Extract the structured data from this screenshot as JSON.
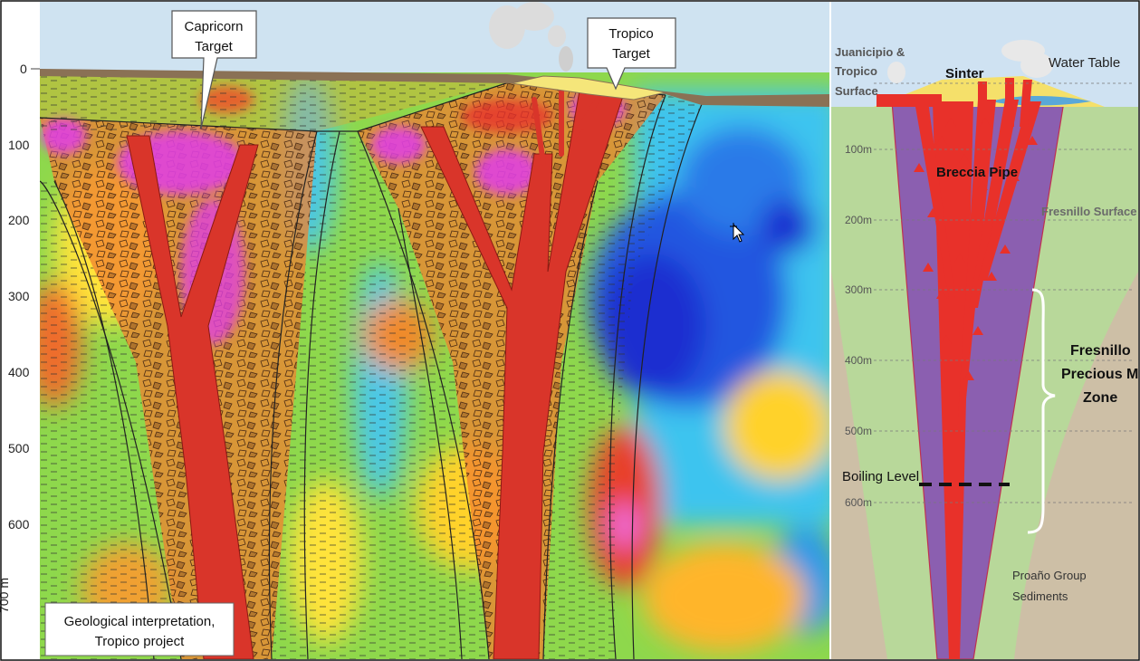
{
  "left_panel": {
    "depth_axis": {
      "ticks": [
        "0",
        "100",
        "200",
        "300",
        "400",
        "500",
        "600",
        "700 m"
      ]
    },
    "callouts": {
      "capricorn": [
        "Capricorn",
        "Target"
      ],
      "tropico": [
        "Tropico",
        "Target"
      ]
    },
    "caption": [
      "Geological interpretation,",
      "Tropico project"
    ]
  },
  "right_panel": {
    "surface_label": [
      "Juanicipio &",
      "Tropico",
      "Surface"
    ],
    "sinter": "Sinter",
    "water_table": "Water Table",
    "breccia_pipe": "Breccia Pipe",
    "fresnillo_surface": "Fresnillo Surface",
    "depth_labels": [
      "100m",
      "200m",
      "300m",
      "400m",
      "500m",
      "600m"
    ],
    "zone_label": [
      "Fresnillo",
      "Precious Meta",
      "Zone"
    ],
    "boiling_level": "Boiling Level",
    "sediments": [
      "Proaño Group",
      "Sediments"
    ]
  },
  "colors": {
    "dike_red": "#d9352a",
    "breccia_purple": "#8b5fb0",
    "sky": "#cfe2f2",
    "ground_tan": "#cdbfa6",
    "green_zone": "#b8d89a"
  }
}
